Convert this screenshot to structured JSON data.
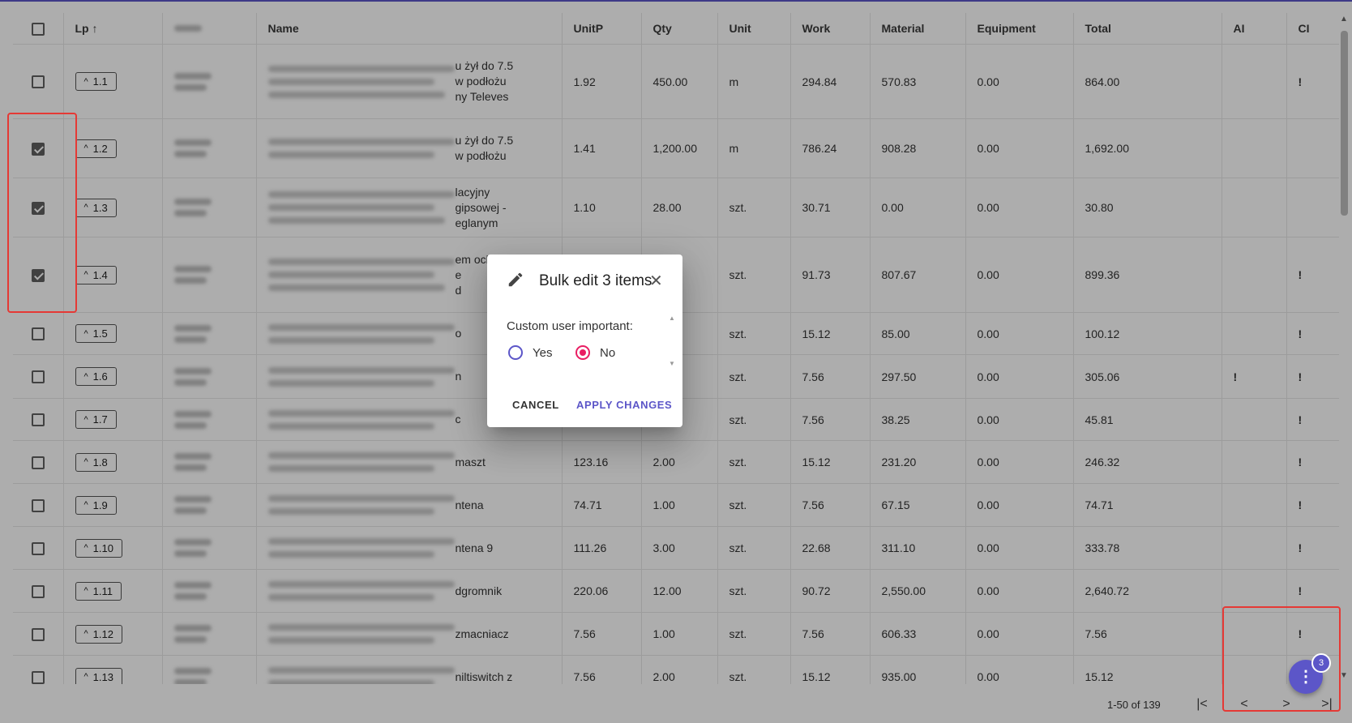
{
  "table": {
    "columns": [
      "Lp",
      "Code",
      "Name",
      "UnitP",
      "Qty",
      "Unit",
      "Work",
      "Material",
      "Equipment",
      "Total",
      "AI",
      "CI"
    ],
    "rows": [
      {
        "lp": "1.1",
        "checked": false,
        "name_tail": [
          "u żył do 7.5",
          "w podłożu",
          "ny Televes"
        ],
        "unitp": "1.92",
        "qty": "450.00",
        "unit": "m",
        "work": "294.84",
        "material": "570.83",
        "equipment": "0.00",
        "total": "864.00",
        "ai": "",
        "ci": "!"
      },
      {
        "lp": "1.2",
        "checked": true,
        "name_tail": [
          "u żył do 7.5",
          "w podłożu"
        ],
        "unitp": "1.41",
        "qty": "1,200.00",
        "unit": "m",
        "work": "786.24",
        "material": "908.28",
        "equipment": "0.00",
        "total": "1,692.00",
        "ai": "",
        "ci": ""
      },
      {
        "lp": "1.3",
        "checked": true,
        "name_tail": [
          "lacyjny",
          "gipsowej -",
          "eglanym"
        ],
        "unitp": "1.10",
        "qty": "28.00",
        "unit": "szt.",
        "work": "30.71",
        "material": "0.00",
        "equipment": "0.00",
        "total": "30.80",
        "ai": "",
        "ci": ""
      },
      {
        "lp": "1.4",
        "checked": true,
        "name_tail": [
          "em ochronnym",
          "e",
          "d"
        ],
        "unitp": "",
        "qty": "3.00",
        "unit": "szt.",
        "work": "91.73",
        "material": "807.67",
        "equipment": "0.00",
        "total": "899.36",
        "ai": "",
        "ci": "!"
      },
      {
        "lp": "1.5",
        "checked": false,
        "name_tail": [
          "o"
        ],
        "unitp": "",
        "qty": "00",
        "unit": "szt.",
        "work": "15.12",
        "material": "85.00",
        "equipment": "0.00",
        "total": "100.12",
        "ai": "",
        "ci": "!"
      },
      {
        "lp": "1.6",
        "checked": false,
        "name_tail": [
          "n"
        ],
        "unitp": "",
        "qty": "00",
        "unit": "szt.",
        "work": "7.56",
        "material": "297.50",
        "equipment": "0.00",
        "total": "305.06",
        "ai": "!",
        "ci": "!"
      },
      {
        "lp": "1.7",
        "checked": false,
        "name_tail": [
          "c"
        ],
        "unitp": "",
        "qty": "00",
        "unit": "szt.",
        "work": "7.56",
        "material": "38.25",
        "equipment": "0.00",
        "total": "45.81",
        "ai": "",
        "ci": "!"
      },
      {
        "lp": "1.8",
        "checked": false,
        "name_tail": [
          "maszt"
        ],
        "unitp": "123.16",
        "qty": "2.00",
        "unit": "szt.",
        "work": "15.12",
        "material": "231.20",
        "equipment": "0.00",
        "total": "246.32",
        "ai": "",
        "ci": "!"
      },
      {
        "lp": "1.9",
        "checked": false,
        "name_tail": [
          "ntena"
        ],
        "unitp": "74.71",
        "qty": "1.00",
        "unit": "szt.",
        "work": "7.56",
        "material": "67.15",
        "equipment": "0.00",
        "total": "74.71",
        "ai": "",
        "ci": "!"
      },
      {
        "lp": "1.10",
        "checked": false,
        "name_tail": [
          "ntena 9"
        ],
        "unitp": "111.26",
        "qty": "3.00",
        "unit": "szt.",
        "work": "22.68",
        "material": "311.10",
        "equipment": "0.00",
        "total": "333.78",
        "ai": "",
        "ci": "!"
      },
      {
        "lp": "1.11",
        "checked": false,
        "name_tail": [
          "dgromnik"
        ],
        "unitp": "220.06",
        "qty": "12.00",
        "unit": "szt.",
        "work": "90.72",
        "material": "2,550.00",
        "equipment": "0.00",
        "total": "2,640.72",
        "ai": "",
        "ci": "!"
      },
      {
        "lp": "1.12",
        "checked": false,
        "name_tail": [
          "zmacniacz"
        ],
        "unitp": "7.56",
        "qty": "1.00",
        "unit": "szt.",
        "work": "7.56",
        "material": "606.33",
        "equipment": "0.00",
        "total": "7.56",
        "ai": "",
        "ci": "!"
      },
      {
        "lp": "1.13",
        "checked": false,
        "name_tail": [
          "niltiswitch z"
        ],
        "unitp": "7.56",
        "qty": "2.00",
        "unit": "szt.",
        "work": "15.12",
        "material": "935.00",
        "equipment": "0.00",
        "total": "15.12",
        "ai": "",
        "ci": "!"
      }
    ]
  },
  "pagination": {
    "range_label": "1-50 of 139"
  },
  "fab": {
    "badge": "3"
  },
  "dialog": {
    "title": "Bulk edit 3 items",
    "field_label": "Custom user important:",
    "options": [
      "Yes",
      "No"
    ],
    "selected": "No",
    "cancel_label": "CANCEL",
    "apply_label": "APPLY CHANGES"
  },
  "colors": {
    "accent": "#5c56c8",
    "radio_selected": "#e91e63",
    "annotation": "#e53935"
  },
  "icons": {
    "edit": "pencil-icon",
    "close": "close-icon",
    "fab": "more-vert-icon",
    "sort": "arrow-up-icon"
  }
}
